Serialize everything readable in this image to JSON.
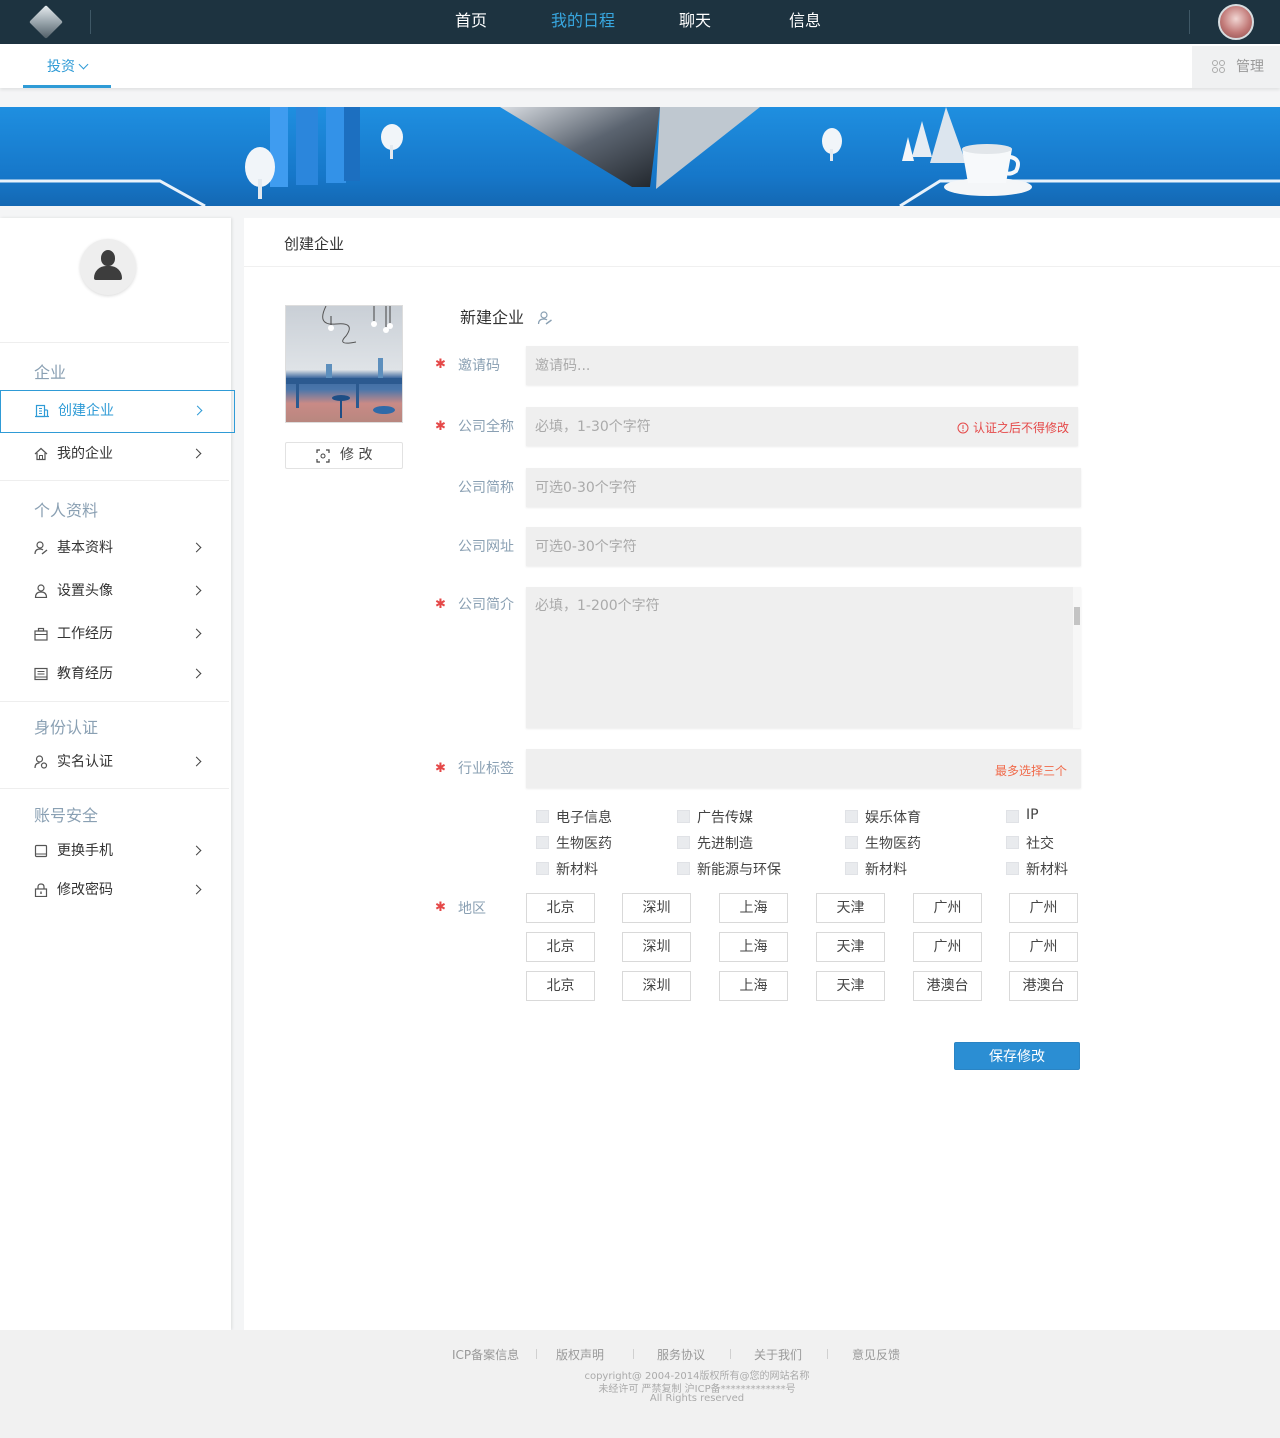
{
  "topnav": {
    "items": [
      "首页",
      "我的日程",
      "聊天",
      "信息"
    ],
    "active_index": 1
  },
  "subnav": {
    "tab_label": "投资",
    "manage_label": "管理"
  },
  "sidebar": {
    "sections": [
      {
        "title": "企业",
        "items": [
          "创建企业",
          "我的企业"
        ]
      },
      {
        "title": "个人资料",
        "items": [
          "基本资料",
          "设置头像",
          "工作经历",
          "教育经历"
        ]
      },
      {
        "title": "身份认证",
        "items": [
          "实名认证"
        ]
      },
      {
        "title": "账号安全",
        "items": [
          "更换手机",
          "修改密码"
        ]
      }
    ],
    "active_item": "创建企业"
  },
  "main": {
    "title": "创建企业",
    "edit_button": "修 改",
    "section_title": "新建企业",
    "fields": {
      "invite": {
        "label": "邀请码",
        "placeholder": "邀请码..."
      },
      "fullname": {
        "label": "公司全称",
        "placeholder": "必填，1-30个字符",
        "hint": "认证之后不得修改"
      },
      "shortname": {
        "label": "公司简称",
        "placeholder": "可选0-30个字符"
      },
      "website": {
        "label": "公司网址",
        "placeholder": "可选0-30个字符"
      },
      "intro": {
        "label": "公司简介",
        "placeholder": "必填，1-200个字符"
      },
      "industry": {
        "label": "行业标签",
        "hint": "最多选择三个"
      },
      "region": {
        "label": "地区"
      }
    },
    "industry_tags": [
      [
        "电子信息",
        "广告传媒",
        "娱乐体育",
        "IP"
      ],
      [
        "生物医药",
        "先进制造",
        "生物医药",
        "社交"
      ],
      [
        "新材料",
        "新能源与环保",
        "新材料",
        "新材料"
      ]
    ],
    "regions": [
      [
        "北京",
        "深圳",
        "上海",
        "天津",
        "广州",
        "广州"
      ],
      [
        "北京",
        "深圳",
        "上海",
        "天津",
        "广州",
        "广州"
      ],
      [
        "北京",
        "深圳",
        "上海",
        "天津",
        "港澳台",
        "港澳台"
      ]
    ],
    "save_button": "保存修改"
  },
  "footer": {
    "links": [
      "ICP备案信息",
      "版权声明",
      "服务协议",
      "关于我们",
      "意见反馈"
    ],
    "lines": [
      "copyright@ 2004-2014版权所有@您的网站名称",
      "未经许可 严禁复制 沪ICP备*************号",
      "All Rights reserved"
    ]
  },
  "colors": {
    "topbar": "#1d3340",
    "accent": "#2f9bd6",
    "required": "#e54848",
    "banner": "#1677c9"
  }
}
